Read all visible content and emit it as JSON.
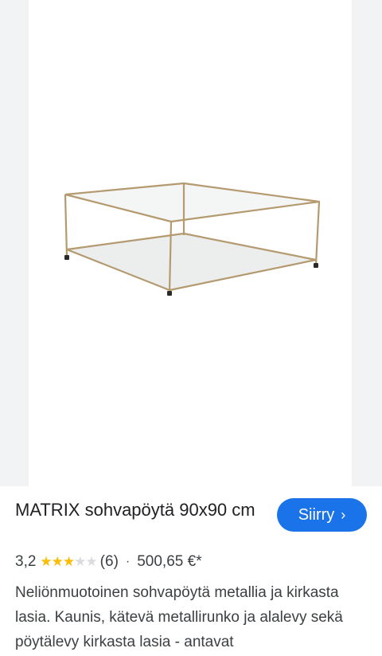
{
  "product": {
    "image_alt": "MATRIX sohvapöytä 90x90 cm",
    "title": "MATRIX sohvapöytä 90x90 cm",
    "rating": "3,2",
    "rating_value": 3.2,
    "rating_max": 5,
    "review_count": "(6)",
    "separator": "·",
    "price": "500,65 €*",
    "description": "Neliönmuotoinen sohvapöytä metallia ja kirkasta lasia. Kaunis, kätevä metallirunko ja alalevy sekä pöytälevy kirkasta lasia - antavat"
  },
  "actions": {
    "go_label": "Siirry",
    "go_icon": "chevron-right-icon",
    "go_glyph": "›"
  },
  "colors": {
    "accent": "#1a73e8",
    "star": "#fbbc04",
    "star_empty": "#dadce0",
    "frame": "#b49a6e"
  }
}
